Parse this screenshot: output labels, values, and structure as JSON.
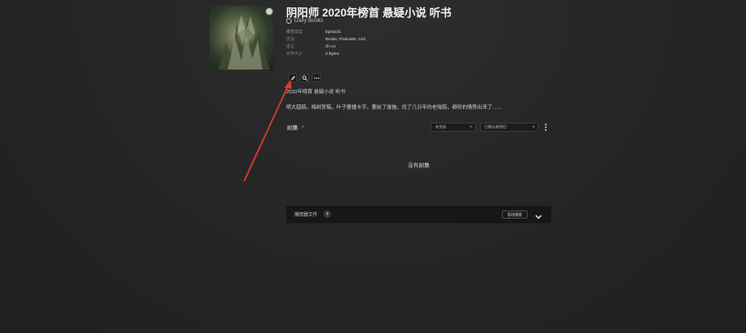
{
  "podcast": {
    "title": "阴阳师 2020年榜首 悬疑小说 听书",
    "author": "Daily Books",
    "author_icon": "podcast-icon"
  },
  "meta": [
    {
      "key": "播客类型",
      "value": "Episodic"
    },
    {
      "key": "流派",
      "value": "Books, Podcasts, Arts"
    },
    {
      "key": "语言",
      "value": "zh-cn"
    },
    {
      "key": "文件大小",
      "value": "0 Bytes"
    }
  ],
  "actions": {
    "edit_icon": "pencil-icon",
    "search_icon": "search-icon",
    "more_icon": "more-horizontal-icon"
  },
  "description": {
    "title": "2020年榜首 悬疑小说 听书",
    "body": "明大腊稿，梅树贺稿，叶子要播卡字，要前了伽施，伐了几日年的老嗡稿，卿则的情势出来了……"
  },
  "episodes": {
    "label": "剧集",
    "count": "0",
    "filter_value": "未完成",
    "sort_value": "日期从新到旧",
    "empty_message": "没有剧集"
  },
  "bottom_bar": {
    "label": "播放器文件",
    "count": "0",
    "manage_label": "管理播客",
    "expand_icon": "chevron-down-icon"
  },
  "annotation": {
    "color": "#e03a2c"
  }
}
